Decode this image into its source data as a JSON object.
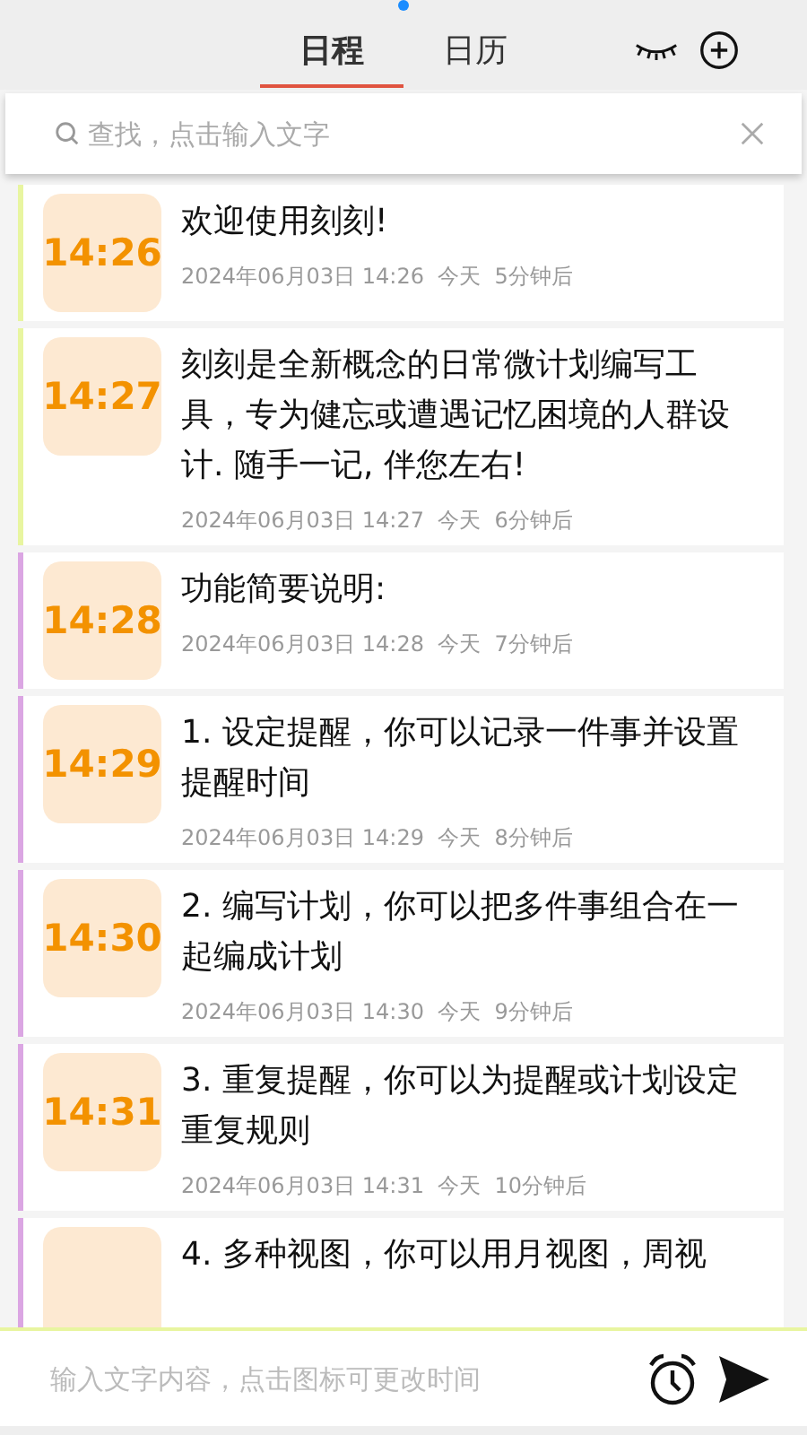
{
  "tabs": [
    {
      "label": "日程",
      "selected": true
    },
    {
      "label": "日历",
      "selected": false
    }
  ],
  "search": {
    "placeholder": "查找，点击输入文字"
  },
  "items": [
    {
      "time": "14:26",
      "text": "欢迎使用刻刻!",
      "meta": "2024年06月03日 14:26  今天  5分钟后",
      "color": "#e8f5a0"
    },
    {
      "time": "14:27",
      "text": "刻刻是全新概念的日常微计划编写工具，专为健忘或遭遇记忆困境的人群设计. 随手一记, 伴您左右!",
      "meta": "2024年06月03日 14:27  今天  6分钟后",
      "color": "#e8f5a0"
    },
    {
      "time": "14:28",
      "text": "功能简要说明:",
      "meta": "2024年06月03日 14:28  今天  7分钟后",
      "color": "#dba6e3"
    },
    {
      "time": "14:29",
      "text": "1. 设定提醒，你可以记录一件事并设置提醒时间",
      "meta": "2024年06月03日 14:29  今天  8分钟后",
      "color": "#dba6e3"
    },
    {
      "time": "14:30",
      "text": "2. 编写计划，你可以把多件事组合在一起编成计划",
      "meta": "2024年06月03日 14:30  今天  9分钟后",
      "color": "#dba6e3"
    },
    {
      "time": "14:31",
      "text": "3. 重复提醒，你可以为提醒或计划设定重复规则",
      "meta": "2024年06月03日 14:31  今天  10分钟后",
      "color": "#dba6e3"
    },
    {
      "text": "4. 多种视图，你可以用月视图，周视",
      "color": "#dba6e3"
    }
  ],
  "composer": {
    "placeholder": "输入文字内容，点击图标可更改时间"
  }
}
